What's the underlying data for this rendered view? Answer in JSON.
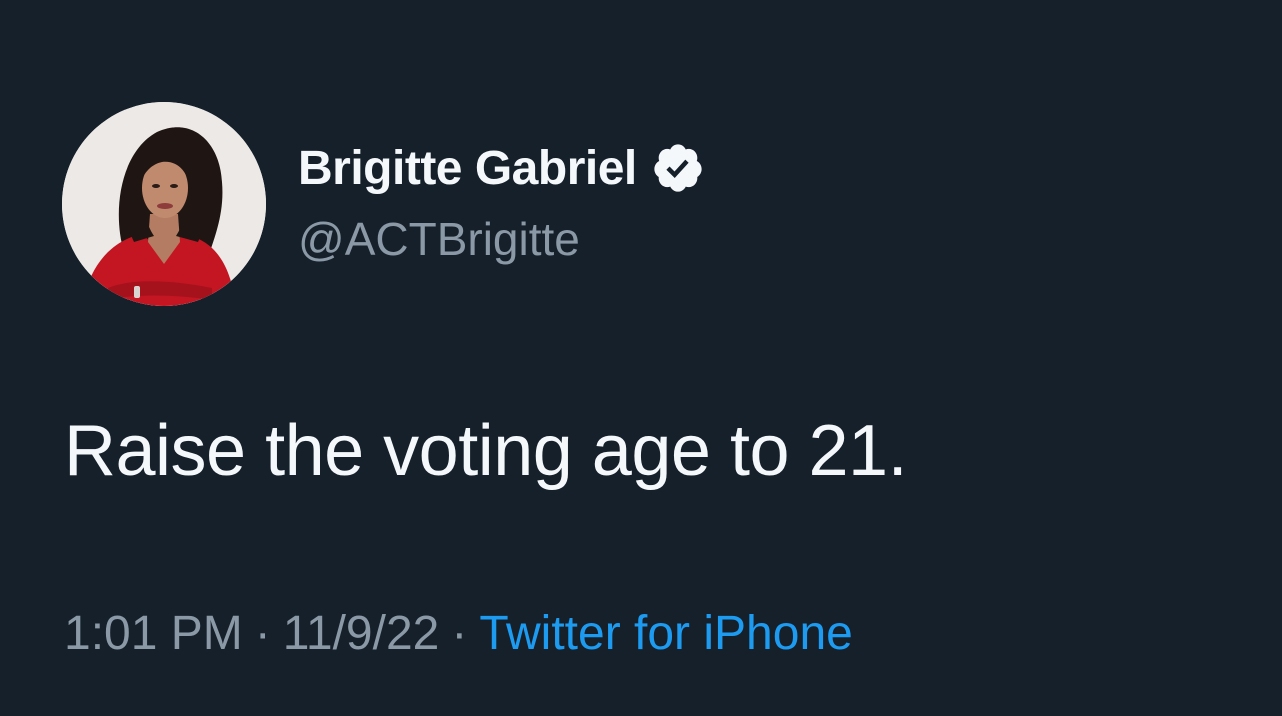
{
  "tweet": {
    "display_name": "Brigitte Gabriel",
    "handle": "@ACTBrigitte",
    "text": "Raise the voting age to 21.",
    "time": "1:01 PM",
    "separator": "·",
    "date": "11/9/22",
    "source": "Twitter for iPhone",
    "verified_icon": "verified-badge-icon"
  },
  "colors": {
    "background": "#15202b",
    "primary_text": "#f5f8fa",
    "secondary_text": "#8b98a5",
    "link": "#1d9bf0"
  }
}
